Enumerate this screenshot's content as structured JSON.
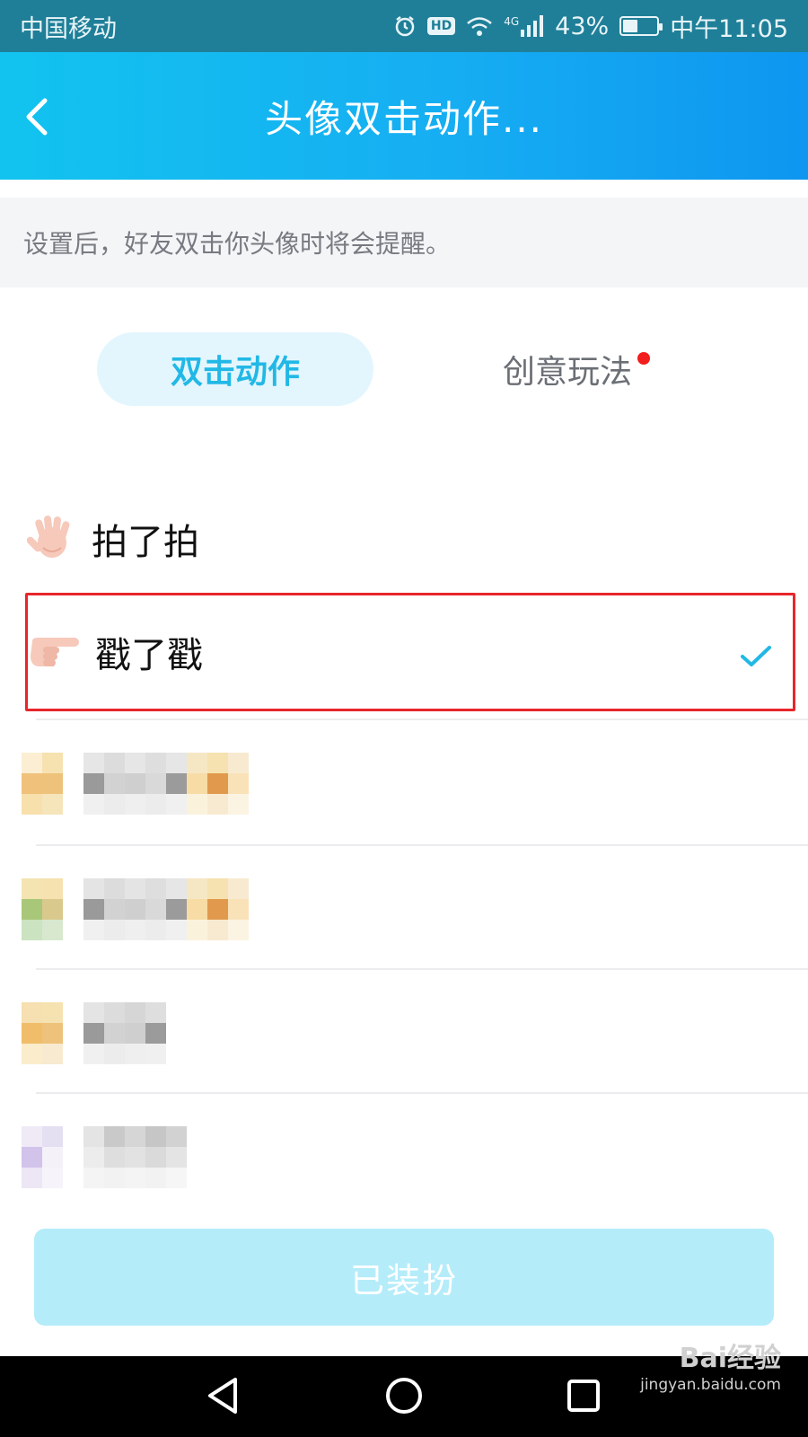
{
  "status_bar": {
    "carrier": "中国移动",
    "network": "4G",
    "battery": "43%",
    "battery_level": 0.43,
    "time": "中午11:05",
    "hd_badge": "HD",
    "icons": [
      "alarm-icon",
      "hd-icon",
      "wifi-icon",
      "signal-icon",
      "battery-icon"
    ]
  },
  "header": {
    "title": "头像双击动作..."
  },
  "hint": {
    "text": "设置后，好友双击你头像时将会提醒。"
  },
  "tabs": [
    {
      "label": "双击动作",
      "selected": true
    },
    {
      "label": "创意玩法",
      "selected": false,
      "has_red_dot": true
    }
  ],
  "options": [
    {
      "label": "拍了拍",
      "icon": "waving-hand-icon",
      "selected": false
    },
    {
      "label": "戳了戳",
      "icon": "pointing-hand-icon",
      "selected": true
    }
  ],
  "apply_button": {
    "label": "已装扮"
  },
  "watermark": {
    "brand": "Bai经验",
    "url": "jingyan.baidu.com"
  },
  "colors": {
    "accent": "#22b8e6",
    "header_gradient_start": "#12c3ef",
    "header_gradient_end": "#0e96f0",
    "highlight_box": "#e8262b",
    "red_dot": "#f21d1d"
  }
}
